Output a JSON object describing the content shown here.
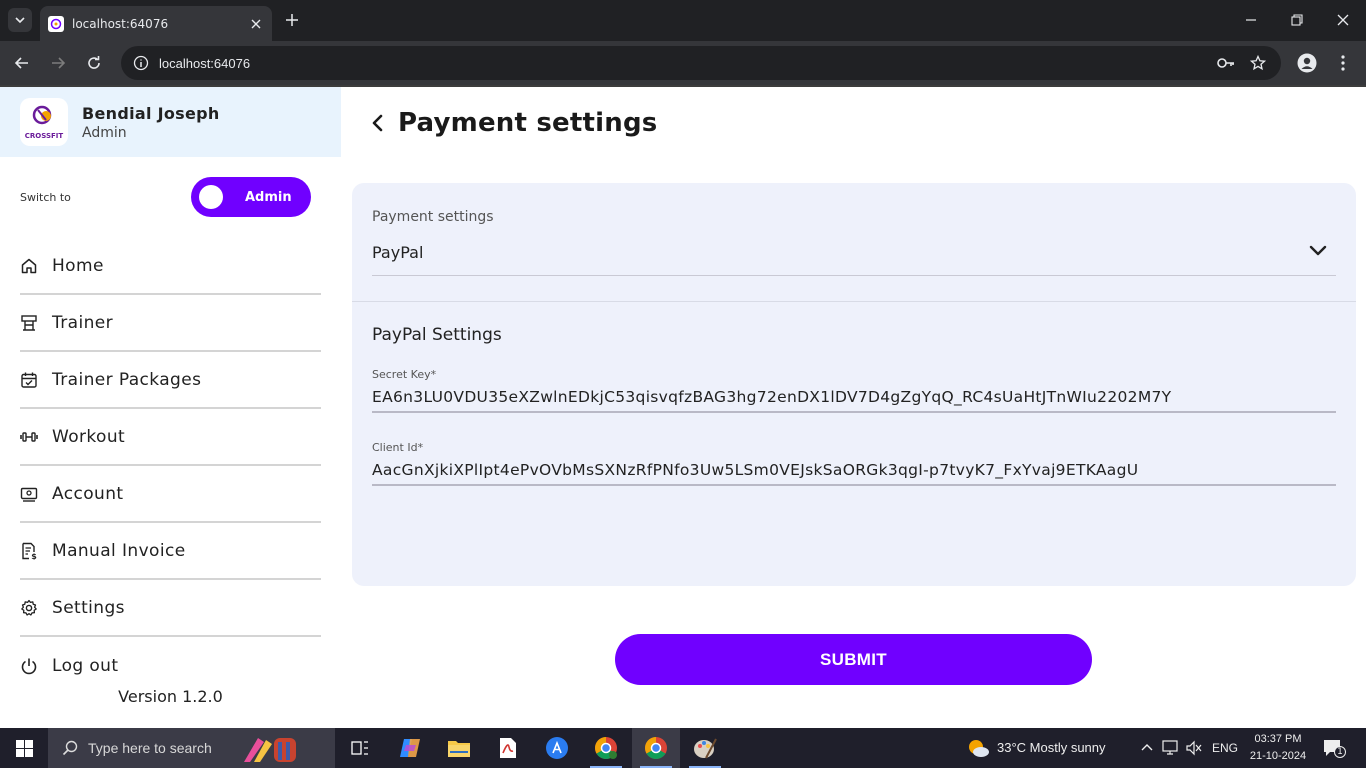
{
  "browser": {
    "tab_title": "localhost:64076",
    "url": "localhost:64076"
  },
  "sidebar": {
    "user_name": "Bendial Joseph",
    "user_role": "Admin",
    "logo_text": "CROSSFIT",
    "switch_label": "Switch to",
    "toggle_label": "Admin",
    "items": [
      {
        "label": "Home",
        "icon": "home-icon"
      },
      {
        "label": "Trainer",
        "icon": "trainer-icon"
      },
      {
        "label": "Trainer Packages",
        "icon": "calendar-icon"
      },
      {
        "label": "Workout",
        "icon": "dumbbell-icon"
      },
      {
        "label": "Account",
        "icon": "account-card-icon"
      },
      {
        "label": "Manual Invoice",
        "icon": "invoice-icon"
      },
      {
        "label": "Settings",
        "icon": "gear-icon"
      },
      {
        "label": "Log out",
        "icon": "power-icon"
      }
    ],
    "version": "Version 1.2.0"
  },
  "main": {
    "title": "Payment settings",
    "select_label": "Payment settings",
    "select_value": "PayPal",
    "section_title": "PayPal Settings",
    "secret_key_label": "Secret Key*",
    "secret_key_value": "EA6n3LU0VDU35eXZwlnEDkjC53qisvqfzBAG3hg72enDX1lDV7D4gZgYqQ_RC4sUaHtJTnWIu2202M7Y",
    "client_id_label": "Client Id*",
    "client_id_value": "AacGnXjkiXPlIpt4ePvOVbMsSXNzRfPNfo3Uw5LSm0VEJskSaORGk3qgI-p7tvyK7_FxYvaj9ETKAagU",
    "submit_label": "SUBMIT"
  },
  "colors": {
    "accent": "#7000ff",
    "profile_bg": "#e8f3fd",
    "card_bg": "#eef1fb"
  },
  "taskbar": {
    "search_placeholder": "Type here to search",
    "weather": "33°C  Mostly sunny",
    "language": "ENG",
    "time": "03:37 PM",
    "date": "21-10-2024",
    "notifications": "1"
  }
}
